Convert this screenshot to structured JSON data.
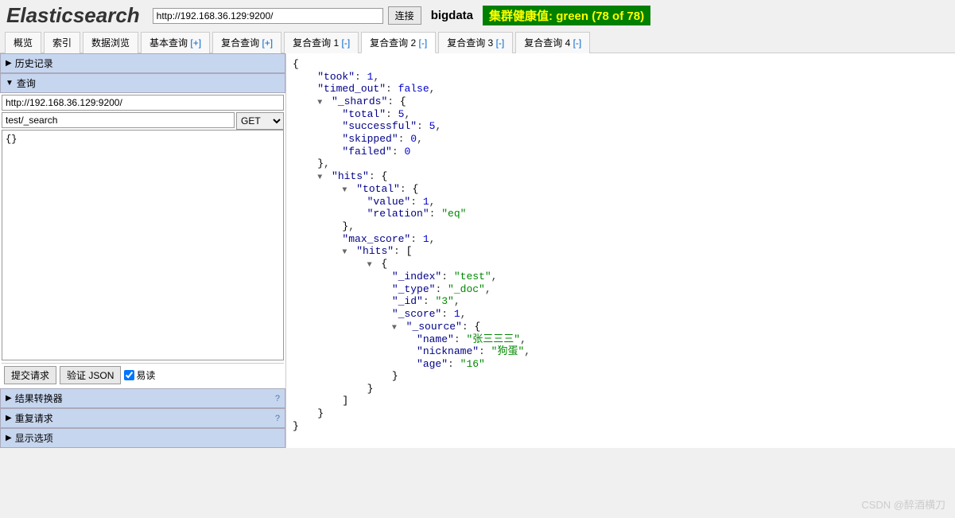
{
  "header": {
    "logo": "Elasticsearch",
    "url": "http://192.168.36.129:9200/",
    "connect_btn": "连接",
    "cluster_name": "bigdata",
    "health": "集群健康值: green (78 of 78)"
  },
  "tabs": [
    {
      "label": "概览",
      "suffix": "",
      "active": false
    },
    {
      "label": "索引",
      "suffix": "",
      "active": false
    },
    {
      "label": "数据浏览",
      "suffix": "",
      "active": false
    },
    {
      "label": "基本查询",
      "suffix": "[+]",
      "suffix_type": "add",
      "active": false
    },
    {
      "label": "复合查询",
      "suffix": "[+]",
      "suffix_type": "add",
      "active": false
    },
    {
      "label": "复合查询 1",
      "suffix": "[-]",
      "suffix_type": "remove",
      "active": false
    },
    {
      "label": "复合查询 2",
      "suffix": "[-]",
      "suffix_type": "remove",
      "active": true
    },
    {
      "label": "复合查询 3",
      "suffix": "[-]",
      "suffix_type": "remove",
      "active": false
    },
    {
      "label": "复合查询 4",
      "suffix": "[-]",
      "suffix_type": "remove",
      "active": false
    }
  ],
  "sidebar": {
    "history": "历史记录",
    "query": "查询",
    "query_url": "http://192.168.36.129:9200/",
    "query_path": "test/_search",
    "method": "GET",
    "body": "{}",
    "submit": "提交请求",
    "validate": "验证 JSON",
    "pretty": "易读",
    "transformer": "结果转换器",
    "repeat": "重复请求",
    "display": "显示选项"
  },
  "json_response": {
    "took": 1,
    "timed_out": false,
    "_shards": {
      "total": 5,
      "successful": 5,
      "skipped": 0,
      "failed": 0
    },
    "hits": {
      "total": {
        "value": 1,
        "relation": "eq"
      },
      "max_score": 1,
      "hits": [
        {
          "_index": "test",
          "_type": "_doc",
          "_id": "3",
          "_score": 1,
          "_source": {
            "name": "张三三三",
            "nickname": "狗蛋",
            "age": "16"
          }
        }
      ]
    }
  },
  "watermark": "CSDN @醉酒横刀"
}
